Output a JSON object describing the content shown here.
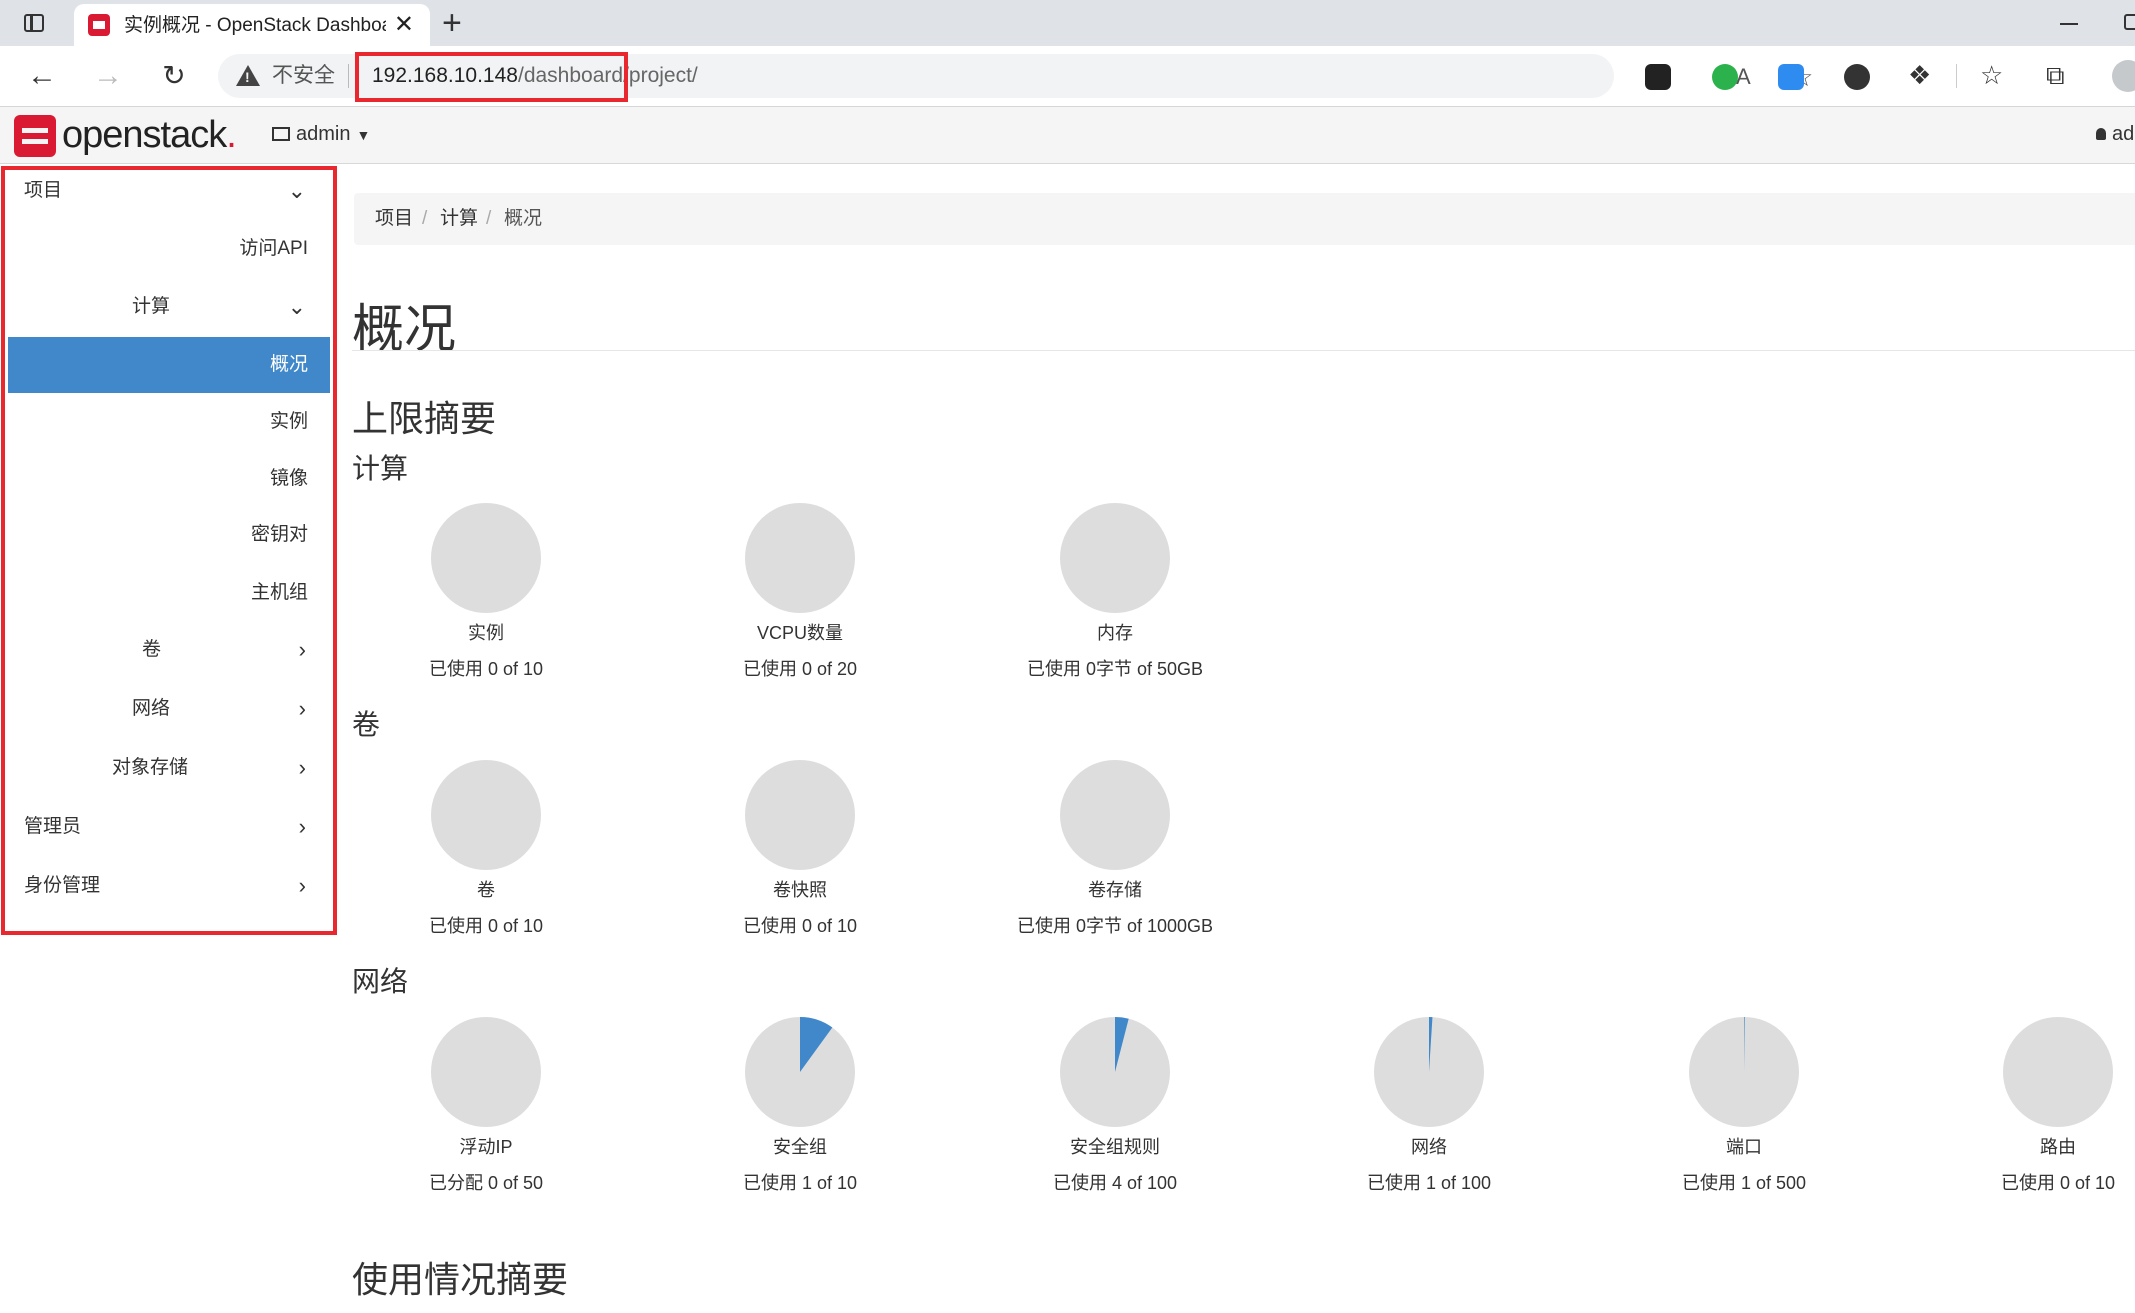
{
  "browser": {
    "tab_title": "实例概况 - OpenStack Dashboard",
    "tab_close": "✕",
    "new_tab": "+",
    "insecure_label": "不安全",
    "url_host": "192.168.10.148",
    "url_path": "/dashboard/project/",
    "read_aloud_icon": "A",
    "favorites_icon": "☆"
  },
  "header": {
    "logo_text": "openstack",
    "logo_dot": ".",
    "project": "admin",
    "user": "ad"
  },
  "sidebar": {
    "items": [
      {
        "label": "项目",
        "chevron": "⌄"
      },
      {
        "label": "访问API"
      },
      {
        "label": "计算",
        "chevron": "⌄"
      },
      {
        "label": "概况"
      },
      {
        "label": "实例"
      },
      {
        "label": "镜像"
      },
      {
        "label": "密钥对"
      },
      {
        "label": "主机组"
      },
      {
        "label": "卷",
        "chevron": "›"
      },
      {
        "label": "网络",
        "chevron": "›"
      },
      {
        "label": "对象存储",
        "chevron": "›"
      },
      {
        "label": "管理员",
        "chevron": "›"
      },
      {
        "label": "身份管理",
        "chevron": "›"
      }
    ]
  },
  "breadcrumb": [
    "项目",
    "计算",
    "概况"
  ],
  "breadcrumb_sep": "/",
  "page_title": "概况",
  "limit_summary_title": "上限摘要",
  "usage_summary_title": "使用情况摘要",
  "colors": {
    "pie_bg": "#dddddd",
    "pie_fill": "#4088ca",
    "accent": "#4088ca",
    "highlight_box": "#e8272e"
  },
  "sections": [
    {
      "title": "计算",
      "charts": [
        {
          "label": "实例",
          "usage": "已使用 0 of 10",
          "used": 0,
          "total": 10
        },
        {
          "label": "VCPU数量",
          "usage": "已使用 0 of 20",
          "used": 0,
          "total": 20
        },
        {
          "label": "内存",
          "usage": "已使用 0字节 of 50GB",
          "used": 0,
          "total": 50
        }
      ]
    },
    {
      "title": "卷",
      "charts": [
        {
          "label": "卷",
          "usage": "已使用 0 of 10",
          "used": 0,
          "total": 10
        },
        {
          "label": "卷快照",
          "usage": "已使用 0 of 10",
          "used": 0,
          "total": 10
        },
        {
          "label": "卷存储",
          "usage": "已使用 0字节 of 1000GB",
          "used": 0,
          "total": 1000
        }
      ]
    },
    {
      "title": "网络",
      "charts": [
        {
          "label": "浮动IP",
          "usage": "已分配 0 of 50",
          "used": 0,
          "total": 50
        },
        {
          "label": "安全组",
          "usage": "已使用 1 of 10",
          "used": 1,
          "total": 10
        },
        {
          "label": "安全组规则",
          "usage": "已使用 4 of 100",
          "used": 4,
          "total": 100
        },
        {
          "label": "网络",
          "usage": "已使用 1 of 100",
          "used": 1,
          "total": 100
        },
        {
          "label": "端口",
          "usage": "已使用 1 of 500",
          "used": 1,
          "total": 500
        },
        {
          "label": "路由",
          "usage": "已使用 0 of 10",
          "used": 0,
          "total": 10
        }
      ]
    }
  ]
}
